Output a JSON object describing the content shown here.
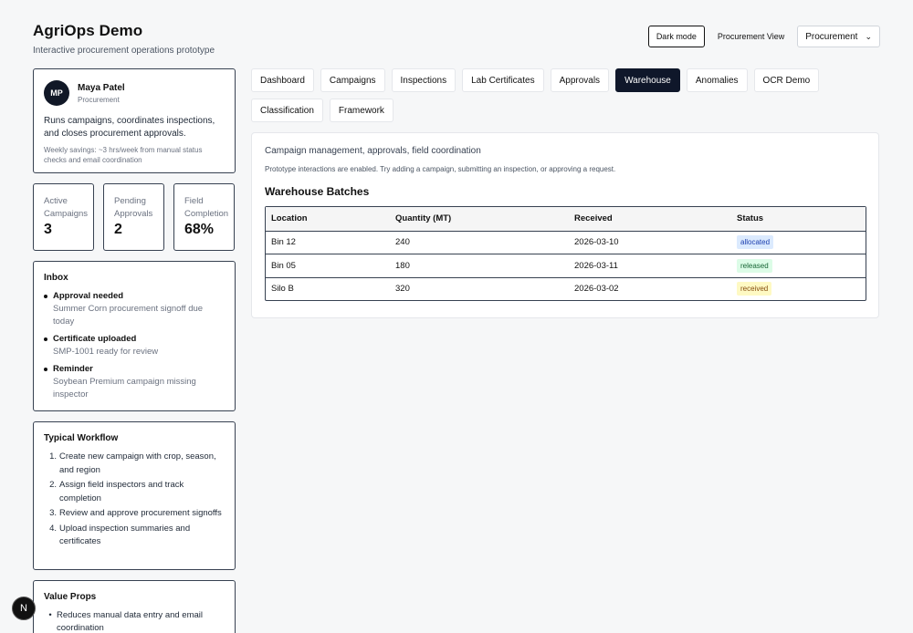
{
  "header": {
    "title": "AgriOps Demo",
    "subtitle": "Interactive procurement operations prototype"
  },
  "controls": {
    "dark_mode_label": "Dark mode",
    "view_label": "Procurement View",
    "role_select_value": "Procurement"
  },
  "profile": {
    "initials": "MP",
    "name": "Maya Patel",
    "role": "Procurement",
    "description": "Runs campaigns, coordinates inspections, and closes procurement approvals.",
    "savings": "Weekly savings: ~3 hrs/week from manual status checks and email coordination"
  },
  "stats": [
    {
      "label": "Active Campaigns",
      "value": "3"
    },
    {
      "label": "Pending Approvals",
      "value": "2"
    },
    {
      "label": "Field Completion",
      "value": "68%"
    }
  ],
  "inbox": {
    "title": "Inbox",
    "items": [
      {
        "title": "Approval needed",
        "desc": "Summer Corn procurement signoff due today"
      },
      {
        "title": "Certificate uploaded",
        "desc": "SMP-1001 ready for review"
      },
      {
        "title": "Reminder",
        "desc": "Soybean Premium campaign missing inspector"
      }
    ]
  },
  "workflow": {
    "title": "Typical Workflow",
    "steps": [
      {
        "num": "1.",
        "text": "Create new campaign with crop, season, and region"
      },
      {
        "num": "2.",
        "text": "Assign field inspectors and track completion"
      },
      {
        "num": "3.",
        "text": "Review and approve procurement signoffs"
      },
      {
        "num": "4.",
        "text": "Upload inspection summaries and certificates"
      }
    ]
  },
  "value_props": {
    "title": "Value Props",
    "items": [
      "Reduces manual data entry and email coordination"
    ]
  },
  "tabs": [
    {
      "label": "Dashboard",
      "active": false
    },
    {
      "label": "Campaigns",
      "active": false
    },
    {
      "label": "Inspections",
      "active": false
    },
    {
      "label": "Lab Certificates",
      "active": false
    },
    {
      "label": "Approvals",
      "active": false
    },
    {
      "label": "Warehouse",
      "active": true
    },
    {
      "label": "Anomalies",
      "active": false
    },
    {
      "label": "OCR Demo",
      "active": false
    },
    {
      "label": "Classification",
      "active": false
    },
    {
      "label": "Framework",
      "active": false
    }
  ],
  "panel": {
    "description": "Campaign management, approvals, field coordination",
    "note": "Prototype interactions are enabled. Try adding a campaign, submitting an inspection, or approving a request.",
    "title": "Warehouse Batches",
    "columns": [
      "Location",
      "Quantity (MT)",
      "Received",
      "Status"
    ],
    "rows": [
      {
        "location": "Bin 12",
        "quantity": "240",
        "received": "2026-03-10",
        "status": "allocated"
      },
      {
        "location": "Bin 05",
        "quantity": "180",
        "received": "2026-03-11",
        "status": "released"
      },
      {
        "location": "Silo B",
        "quantity": "320",
        "received": "2026-03-02",
        "status": "received"
      }
    ]
  },
  "fab_label": "N"
}
